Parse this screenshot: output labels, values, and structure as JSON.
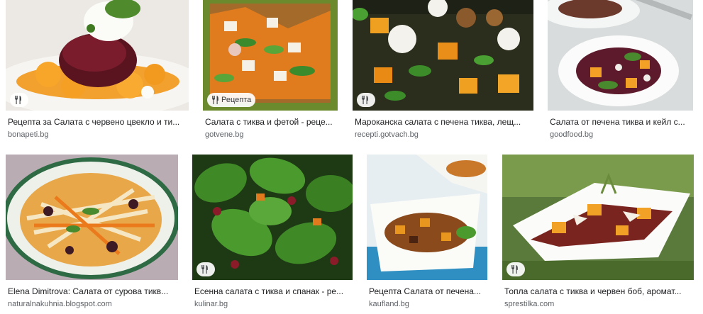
{
  "results": [
    {
      "title": "Рецепта за Салата с червено цвекло и ти...",
      "source": "bonapeti.bg",
      "badge_label": "",
      "icon": "fork-knife-icon"
    },
    {
      "title": "Салата с тиква и фетой - реце...",
      "source": "gotvene.bg",
      "badge_label": "Рецепта",
      "icon": "fork-knife-icon"
    },
    {
      "title": "Мароканска салата с печена тиква, лещ...",
      "source": "recepti.gotvach.bg",
      "badge_label": "",
      "icon": "fork-knife-icon"
    },
    {
      "title": "Салата от печена тиква и кейл с...",
      "source": "goodfood.bg",
      "badge_label": "",
      "icon": "fork-knife-icon"
    },
    {
      "title": "Elena Dimitrova: Салата от сурова тикв...",
      "source": "naturalnakuhnia.blogspot.com",
      "badge_label": "",
      "icon": "fork-knife-icon"
    },
    {
      "title": "Есенна салата с тиква и спанак - ре...",
      "source": "kulinar.bg",
      "badge_label": "",
      "icon": "fork-knife-icon"
    },
    {
      "title": "Рецепта Салата от печена...",
      "source": "kaufland.bg",
      "badge_label": "",
      "icon": "fork-knife-icon"
    },
    {
      "title": "Топла салата с тиква и червен боб, аромат...",
      "source": "sprestilka.com",
      "badge_label": "",
      "icon": "fork-knife-icon"
    }
  ]
}
